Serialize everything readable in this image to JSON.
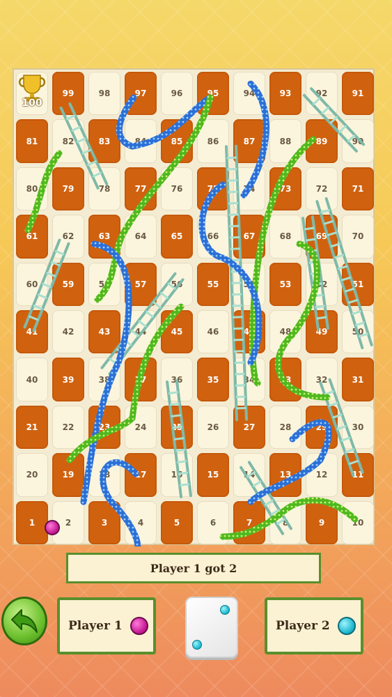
{
  "board": {
    "rows": [
      [
        100,
        99,
        98,
        97,
        96,
        95,
        94,
        93,
        92,
        91
      ],
      [
        81,
        82,
        83,
        84,
        85,
        86,
        87,
        88,
        89,
        90
      ],
      [
        80,
        79,
        78,
        77,
        76,
        75,
        74,
        73,
        72,
        71
      ],
      [
        61,
        62,
        63,
        64,
        65,
        66,
        67,
        68,
        69,
        70
      ],
      [
        60,
        59,
        58,
        57,
        56,
        55,
        54,
        53,
        52,
        51
      ],
      [
        41,
        42,
        43,
        44,
        45,
        46,
        47,
        48,
        49,
        50
      ],
      [
        40,
        39,
        38,
        37,
        36,
        35,
        34,
        33,
        32,
        31
      ],
      [
        21,
        22,
        23,
        24,
        25,
        26,
        27,
        28,
        29,
        30
      ],
      [
        20,
        19,
        18,
        17,
        16,
        15,
        14,
        13,
        12,
        11
      ],
      [
        1,
        2,
        3,
        4,
        5,
        6,
        7,
        8,
        9,
        10
      ]
    ],
    "trophy_label": "100",
    "colors": {
      "dark_tile": "#d0620f",
      "light_tile": "#fbf5de",
      "ladder": "#9fd8c8"
    }
  },
  "token": {
    "player": "Player 1",
    "square": 2,
    "color": "#c1148e"
  },
  "status": {
    "message": "Player 1 got 2"
  },
  "controls": {
    "back_icon": "back-arrow-icon"
  },
  "players": [
    {
      "name": "Player 1",
      "color": "#c1148e"
    },
    {
      "name": "Player 2",
      "color": "#20b8c9"
    }
  ],
  "dice": {
    "value": 2,
    "pip_color": "#17b3c9"
  }
}
